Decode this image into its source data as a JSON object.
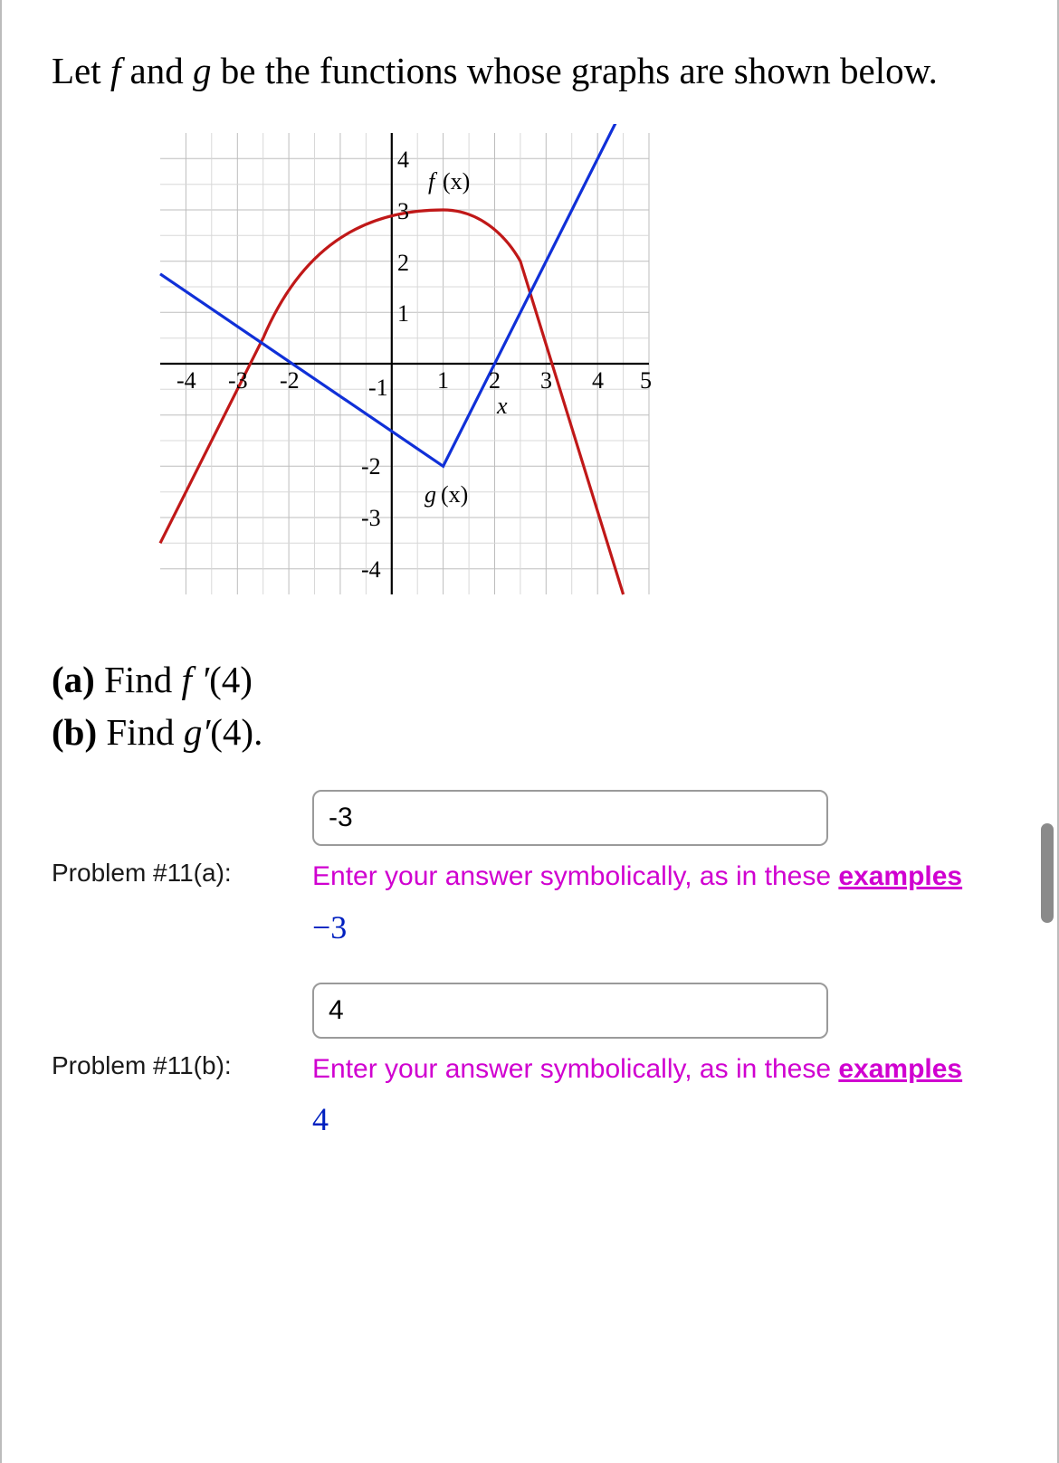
{
  "prompt_prefix": "Let ",
  "prompt_f": "f",
  "prompt_and": " and ",
  "prompt_g": "g",
  "prompt_rest": " be the functions whose graphs are shown below.",
  "subq_a_bold": "(a)",
  "subq_a_text": " Find  ",
  "subq_a_fn": "f ′",
  "subq_a_arg": "(4)",
  "subq_b_bold": "(b)",
  "subq_b_text": " Find  ",
  "subq_b_fn": "g′",
  "subq_b_arg": "(4).",
  "label_a": "Problem #11(a):",
  "label_b": "Problem #11(b):",
  "input_a": "-3",
  "input_b": "4",
  "hint_pre": "Enter your answer symbolically, as in these ",
  "hint_link": "examples",
  "parsed_a": "−3",
  "parsed_b": "4",
  "chart_data": {
    "type": "line",
    "xlim": [
      -4.5,
      5
    ],
    "ylim": [
      -4.5,
      4.5
    ],
    "xticks": [
      -4,
      -3,
      -2,
      -1,
      1,
      2,
      3,
      4,
      5
    ],
    "yticks": [
      -4,
      -3,
      -2,
      -1,
      1,
      2,
      3,
      4
    ],
    "x_axis_label": "x",
    "series": [
      {
        "name": "g(x)",
        "color": "#1030d8",
        "label_pos": [
          0.9,
          -2.6
        ],
        "points": [
          [
            -4.5,
            1.75
          ],
          [
            1,
            -2
          ],
          [
            4.5,
            5
          ]
        ]
      },
      {
        "name": "f(x)",
        "color": "#c01818",
        "label_pos": [
          0.8,
          3.55
        ],
        "segments": [
          [
            [
              -4.5,
              -3.5
            ],
            [
              -2.5,
              0.5
            ]
          ],
          null,
          [
            [
              2.5,
              2
            ],
            [
              4.5,
              -4.5
            ]
          ]
        ],
        "curve_hint": "smooth hump from (-2.5,0.5) peak ~ (1.5,3) to (2.5,2)"
      }
    ]
  }
}
